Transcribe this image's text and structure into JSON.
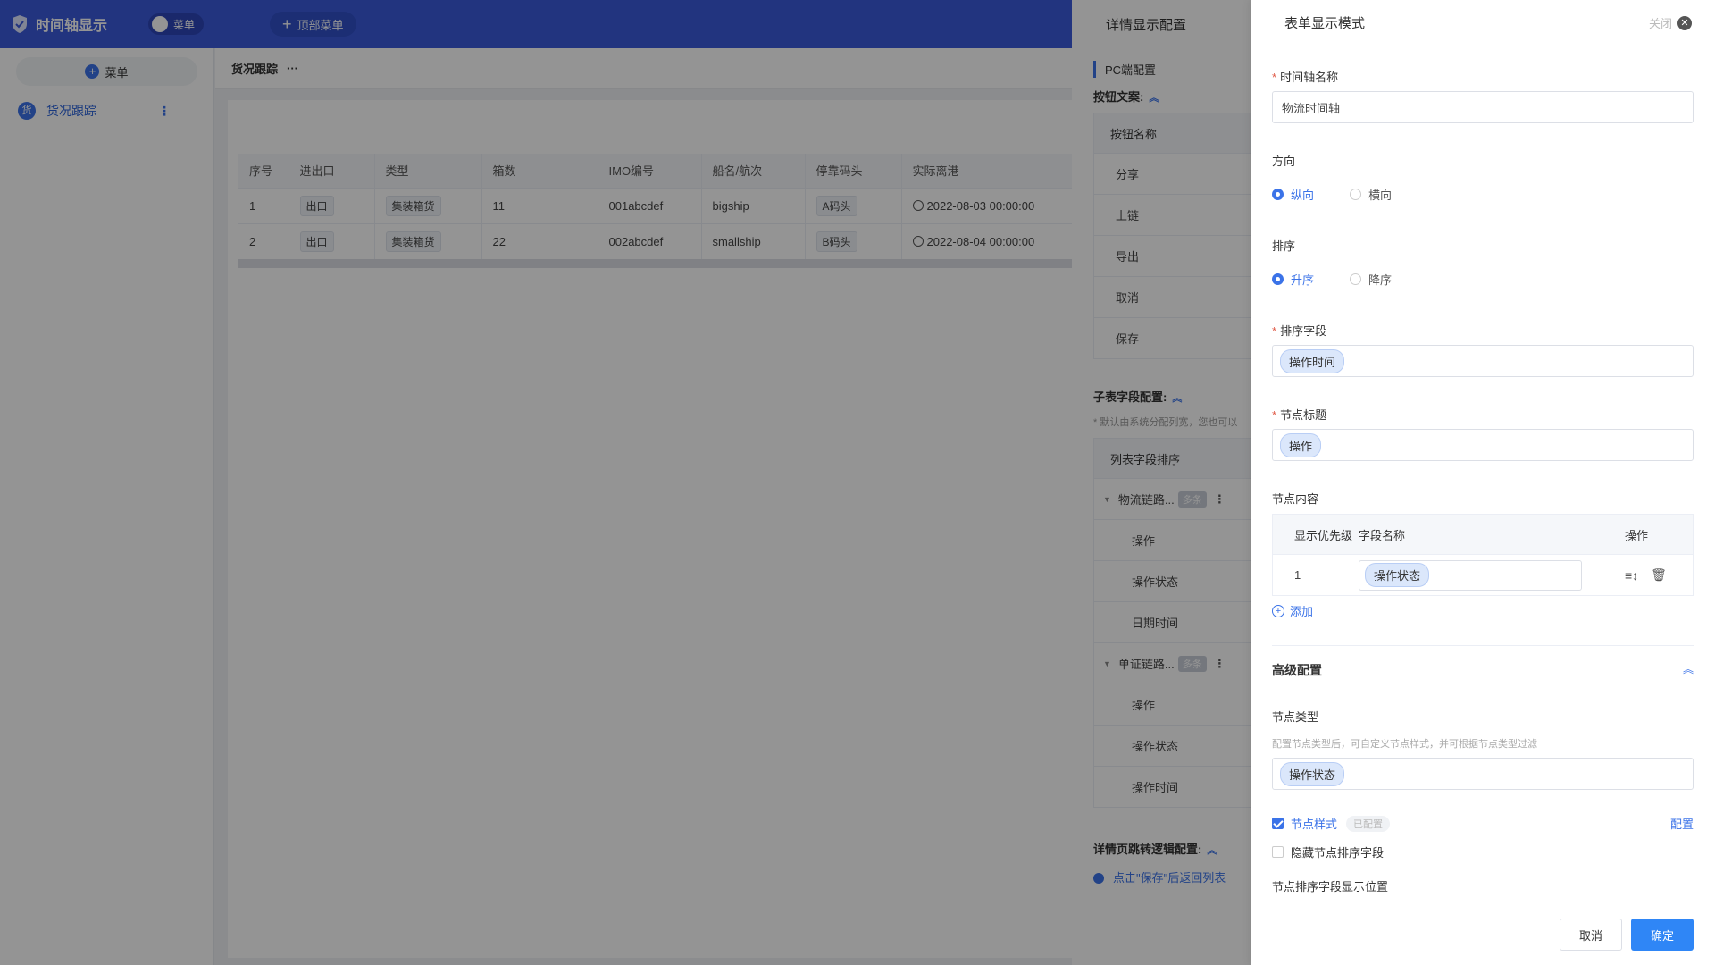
{
  "header": {
    "app_title": "时间轴显示",
    "toggle_label": "菜单",
    "top_menu_button": "顶部菜单",
    "brand_color": "#3b5bdb"
  },
  "sidebar": {
    "add_menu_label": "菜单",
    "items": [
      {
        "avatar": "货",
        "label": "货况跟踪"
      }
    ]
  },
  "main": {
    "breadcrumb": "货况跟踪",
    "breadcrumb_more": "···",
    "table": {
      "columns": [
        "序号",
        "进出口",
        "类型",
        "箱数",
        "IMO编号",
        "船名/航次",
        "停靠码头",
        "实际离港"
      ],
      "rows": [
        {
          "no": "1",
          "io": "出口",
          "type": "集装箱货",
          "boxes": "11",
          "imo": "001abcdef",
          "ship": "bigship",
          "dock": "A码头",
          "depart": "2022-08-03 00:00:00"
        },
        {
          "no": "2",
          "io": "出口",
          "type": "集装箱货",
          "boxes": "22",
          "imo": "002abcdef",
          "ship": "smallship",
          "dock": "B码头",
          "depart": "2022-08-04 00:00:00"
        }
      ]
    }
  },
  "detail_drawer": {
    "title": "详情显示配置",
    "pc_section": "PC端配置",
    "button_text_section": "按钮文案:",
    "button_list_header": "按钮名称",
    "buttons": [
      "分享",
      "上链",
      "导出",
      "取消",
      "保存"
    ],
    "subtable_section": "子表字段配置:",
    "subtable_note": "* 默认由系统分配列宽，您也可以",
    "field_list_header": "列表字段排序",
    "groups": [
      {
        "name": "物流链路...",
        "badge": "多条",
        "fields": [
          "操作",
          "操作状态",
          "日期时间"
        ]
      },
      {
        "name": "单证链路...",
        "badge": "多条",
        "fields": [
          "操作",
          "操作状态",
          "操作时间"
        ]
      }
    ],
    "jump_section": "详情页跳转逻辑配置:",
    "jump_option": "点击\"保存\"后返回列表"
  },
  "form_drawer": {
    "title": "表单显示模式",
    "close_label": "关闭",
    "timeline_name_label": "时间轴名称",
    "timeline_name_value": "物流时间轴",
    "direction_label": "方向",
    "direction_options": [
      "纵向",
      "横向"
    ],
    "direction_selected": "纵向",
    "sort_label": "排序",
    "sort_options": [
      "升序",
      "降序"
    ],
    "sort_selected": "升序",
    "sort_field_label": "排序字段",
    "sort_field_value": "操作时间",
    "node_title_label": "节点标题",
    "node_title_value": "操作",
    "node_content_label": "节点内容",
    "node_table": {
      "headers": [
        "显示优先级",
        "字段名称",
        "操作"
      ],
      "rows": [
        {
          "priority": "1",
          "field": "操作状态"
        }
      ]
    },
    "add_label": "添加",
    "advanced_title": "高级配置",
    "node_type_label": "节点类型",
    "node_type_hint": "配置节点类型后，可自定义节点样式，并可根据节点类型过滤",
    "node_type_value": "操作状态",
    "node_style_label": "节点样式",
    "node_style_checked": true,
    "configured_badge": "已配置",
    "config_link": "配置",
    "hide_sort_field_label": "隐藏节点排序字段",
    "hide_sort_field_checked": false,
    "sort_field_position_label": "节点排序字段显示位置",
    "cancel_button": "取消",
    "confirm_button": "确定",
    "accent_color": "#3b73e8"
  }
}
